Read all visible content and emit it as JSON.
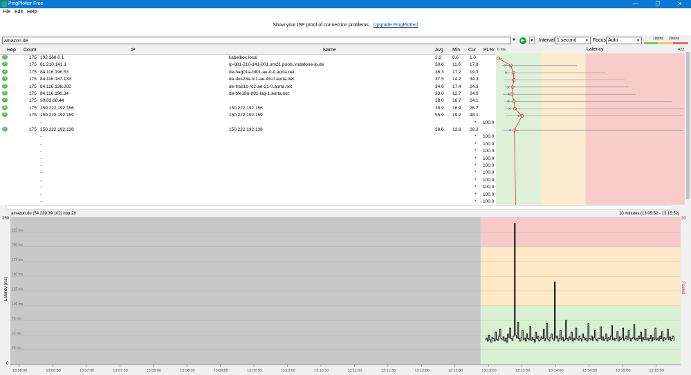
{
  "window": {
    "title": "PingPlotter Free",
    "minimize": "—",
    "maximize": "☐",
    "close": "✕"
  },
  "menu": [
    {
      "label": "File"
    },
    {
      "label": "Edit"
    },
    {
      "label": "Help"
    }
  ],
  "promo": {
    "text": "Show your ISP proof of connection problems.",
    "link": "Upgrade PingPlotter!"
  },
  "toolbar": {
    "target": "amazon.de",
    "interval_label": "Interval",
    "interval_value": "1 second",
    "focus_label": "Focus",
    "focus_value": "Auto",
    "scale_100": "100ms",
    "scale_200": "200ms"
  },
  "table": {
    "headers": {
      "hop": "Hop",
      "count": "Count",
      "ip": "IP",
      "name": "Name",
      "avg": "Avg",
      "min": "Min",
      "cur": "Cur",
      "pl": "PL%",
      "zero": "0 ms",
      "latency": "Latency",
      "max": "422"
    },
    "rows": [
      {
        "hop": "1",
        "count": "175",
        "ip": "192.168.0.1",
        "name": "kabelbox.local",
        "avg": "2.2",
        "min": "0.6",
        "cur": "1.0",
        "pl": ""
      },
      {
        "hop": "2",
        "count": "175",
        "ip": "81.210.141.1",
        "name": "ip-081-210-141-001.um21.pools.vodafone-ip.de",
        "avg": "30.6",
        "min": "11.6",
        "cur": "17.8",
        "pl": ""
      },
      {
        "hop": "3",
        "count": "175",
        "ip": "84.116.196.53",
        "name": "de-hag01a-rd01-ae-0-0.aorta.net",
        "avg": "36.3",
        "min": "17.2",
        "cur": "19.3",
        "pl": ""
      },
      {
        "hop": "4",
        "count": "175",
        "ip": "84.116.187.133",
        "name": "de-dus23e-rc1-ae-45-0.aorta.net",
        "avg": "37.5",
        "min": "14.2",
        "cur": "34.3",
        "pl": ""
      },
      {
        "hop": "5",
        "count": "175",
        "ip": "84.116.138.202",
        "name": "de-fra01b-rc2-ae-21-0.aorta.net",
        "avg": "34.6",
        "min": "17.4",
        "cur": "24.3",
        "pl": ""
      },
      {
        "hop": "6",
        "count": "175",
        "ip": "84.116.190.34",
        "name": "de-bfe18a-rt01-lag-1.aorta.net",
        "avg": "33.0",
        "min": "12.7",
        "cur": "24.9",
        "pl": ""
      },
      {
        "hop": "7",
        "count": "175",
        "ip": "99.83.68.44",
        "name": "",
        "avg": "38.0",
        "min": "16.7",
        "cur": "24.1",
        "pl": ""
      },
      {
        "hop": "8",
        "count": "175",
        "ip": "150.222.192.156",
        "name": "150.222.192.156",
        "avg": "39.9",
        "min": "16.9",
        "cur": "26.7",
        "pl": ""
      },
      {
        "hop": "9",
        "count": "175",
        "ip": "150.222.192.159",
        "name": "150.222.192.159",
        "avg": "55.9",
        "min": "19.2",
        "cur": "48.1",
        "pl": ""
      },
      {
        "hop": "",
        "count": "",
        "ip": "-",
        "name": "",
        "avg": "",
        "min": "",
        "cur": "*",
        "pl": "100.0"
      },
      {
        "hop": "11",
        "count": "175",
        "ip": "150.222.192.138",
        "name": "150.222.192.138",
        "avg": "38.6",
        "min": "13.8",
        "cur": "28.3",
        "pl": ""
      },
      {
        "hop": "",
        "count": "",
        "ip": "-",
        "name": "",
        "avg": "",
        "min": "",
        "cur": "*",
        "pl": "100.0"
      },
      {
        "hop": "",
        "count": "",
        "ip": "-",
        "name": "",
        "avg": "",
        "min": "",
        "cur": "*",
        "pl": "100.0"
      },
      {
        "hop": "",
        "count": "",
        "ip": "-",
        "name": "",
        "avg": "",
        "min": "",
        "cur": "*",
        "pl": "100.0"
      },
      {
        "hop": "",
        "count": "",
        "ip": "-",
        "name": "",
        "avg": "",
        "min": "",
        "cur": "*",
        "pl": "100.0"
      },
      {
        "hop": "",
        "count": "",
        "ip": "-",
        "name": "",
        "avg": "",
        "min": "",
        "cur": "*",
        "pl": "100.0"
      },
      {
        "hop": "",
        "count": "",
        "ip": "-",
        "name": "",
        "avg": "",
        "min": "",
        "cur": "*",
        "pl": "100.0"
      },
      {
        "hop": "",
        "count": "",
        "ip": "-",
        "name": "",
        "avg": "",
        "min": "",
        "cur": "*",
        "pl": "100.0"
      },
      {
        "hop": "",
        "count": "",
        "ip": "-",
        "name": "",
        "avg": "",
        "min": "",
        "cur": "*",
        "pl": "100.0"
      },
      {
        "hop": "",
        "count": "",
        "ip": "-",
        "name": "",
        "avg": "",
        "min": "",
        "cur": "*",
        "pl": "100.0"
      },
      {
        "hop": "",
        "count": "",
        "ip": "-",
        "name": "",
        "avg": "",
        "min": "",
        "cur": "*",
        "pl": "100.0"
      }
    ]
  },
  "lower": {
    "target_label": "amazon.de (54.239.39.102) hop 28",
    "range_label": "10 minutes (13:05:52 - 13:15:52)",
    "y_top": "250",
    "y_zero": "0",
    "pl_top": "30",
    "ylabel": "Latency (ms)",
    "pl_label": "Packet Loss %"
  },
  "chart_data": {
    "type": "line",
    "title": "",
    "xlabel": "",
    "ylabel": "Latency (ms)",
    "y2label": "Packet Loss %",
    "ylim": [
      0,
      250
    ],
    "y2lim": [
      0,
      30
    ],
    "bands": [
      {
        "from": 0,
        "to": 100,
        "color": "#d9f0d3"
      },
      {
        "from": 100,
        "to": 200,
        "color": "#fde9c8"
      },
      {
        "from": 200,
        "to": 250,
        "color": "#f8c9c9"
      }
    ],
    "ytick_labels": [
      "0",
      "25 ms",
      "50 ms",
      "75 ms",
      "100 ms",
      "125 ms",
      "150 ms",
      "175 ms",
      "200 ms",
      "225 ms",
      "250"
    ],
    "x_ticks": [
      "13:06:00",
      "13:06:30",
      "13:07:00",
      "13:07:30",
      "13:08:00",
      "13:08:30",
      "13:09:00",
      "13:09:30",
      "13:10:00",
      "13:10:30",
      "13:11:00",
      "13:11:30",
      "13:12:00",
      "13:12:30",
      "13:13:00",
      "13:13:30",
      "13:14:00",
      "13:14:30",
      "13:15:00",
      "13:15:30"
    ],
    "x_range_seconds": [
      0,
      600
    ],
    "data_start_seconds": 421,
    "series": [
      {
        "name": "amazon.de",
        "x_seconds_step": 1,
        "values": [
          42,
          45,
          40,
          50,
          42,
          38,
          46,
          44,
          40,
          55,
          43,
          41,
          48,
          60,
          44,
          42,
          47,
          40,
          45,
          38,
          52,
          46,
          62,
          44,
          41,
          48,
          240,
          50,
          45,
          72,
          44,
          40,
          46,
          58,
          42,
          45,
          40,
          52,
          44,
          42,
          65,
          41,
          46,
          43,
          38,
          55,
          44,
          48,
          40,
          42,
          47,
          44,
          60,
          41,
          45,
          70,
          43,
          40,
          46,
          52,
          44,
          41,
          140,
          45,
          48,
          40,
          44,
          58,
          42,
          46,
          40,
          42,
          75,
          44,
          41,
          47,
          43,
          55,
          40,
          45,
          42,
          62,
          44,
          41,
          48,
          44,
          40,
          52,
          46,
          42,
          45,
          40,
          70,
          44,
          42,
          48,
          41,
          46,
          58,
          43,
          40,
          45,
          44,
          64,
          42,
          47,
          41,
          44,
          52,
          40,
          46,
          43,
          48,
          66,
          42,
          45,
          41,
          44,
          56,
          40,
          47,
          43,
          45,
          62,
          41,
          44,
          48,
          42,
          58,
          45,
          40,
          44,
          46,
          68,
          42,
          45,
          41,
          48,
          44,
          55,
          40,
          46,
          43,
          60,
          42,
          45,
          41,
          44,
          50,
          40,
          46,
          43,
          62,
          42,
          45,
          41,
          48,
          44,
          56,
          40,
          46,
          43,
          45,
          60,
          42,
          47,
          41,
          44,
          48,
          40
        ]
      }
    ]
  }
}
